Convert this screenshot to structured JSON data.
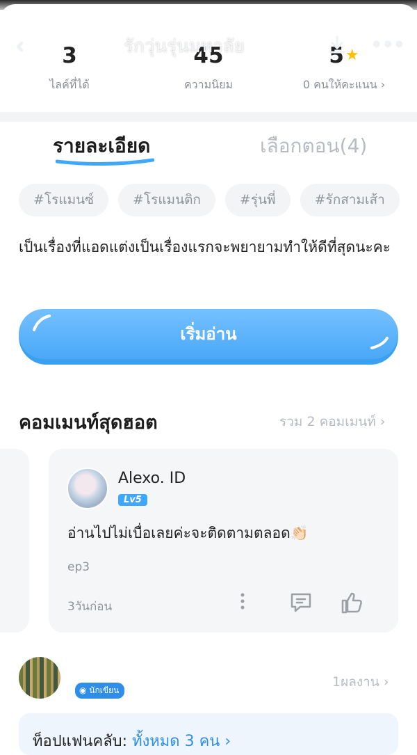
{
  "nav": {
    "back_glyph": "‹",
    "title": "รักวุ่นรุ่นมหาลัย",
    "more_glyph": "•••"
  },
  "stats": [
    {
      "value": "3",
      "label": "ไลค์ที่ได้"
    },
    {
      "value": "45",
      "label": "ความนิยม"
    },
    {
      "value": "5",
      "label": "0 คนให้คะแนน ›"
    }
  ],
  "tabs": {
    "details": "รายละเอียด",
    "episodes": "เลือกตอน(4)"
  },
  "tags": [
    "#โรแมนซ์",
    "#โรแมนติก",
    "#รุ่นพี่",
    "#รักสามเส้า"
  ],
  "description": "เป็นเรื่องที่แอดแต่งเป็นเรื่องแรกจะพยายามทำให้ดีที่สุดนะคะ",
  "read_button": "เริ่มอ่าน",
  "hot_comments": {
    "title": "คอมเมนท์สุดฮอต",
    "total": "รวม 2 คอมเมนท์ ›",
    "comment": {
      "username": "Alexo. ID",
      "level": "Lv5",
      "text": "อ่านไปไม่เบื่อเลยค่ะจะติดตามตลอด👏🏻",
      "episode": "ep3",
      "time": "3วันก่อน"
    }
  },
  "author": {
    "badge": "นักเขียน",
    "works": "1ผลงาน ›"
  },
  "fans": {
    "label": "ท็อปแฟนคลับ:",
    "link": "ทั้งหมด 3 คน ›"
  },
  "colors": {
    "accent": "#40a7ff",
    "star": "#ffc000"
  }
}
